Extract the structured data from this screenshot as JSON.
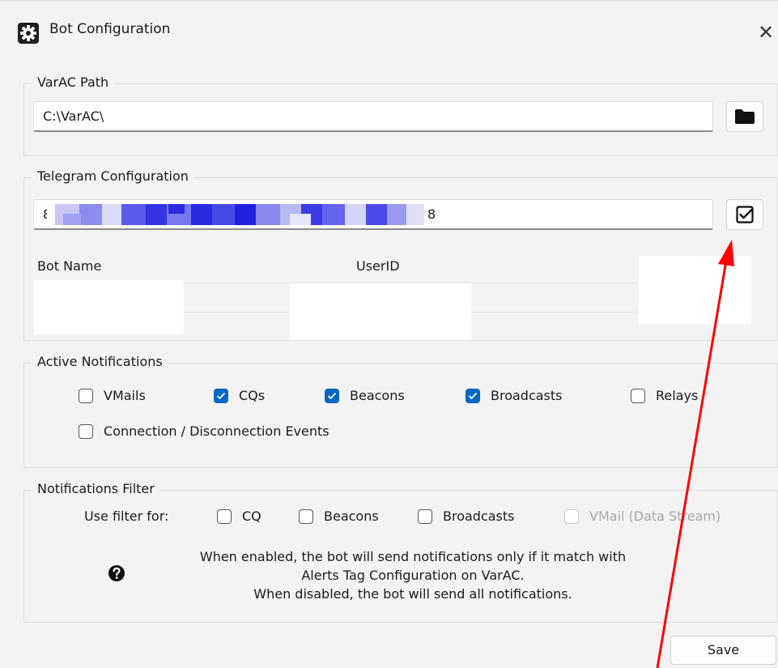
{
  "window": {
    "title": "Bot Configuration",
    "close_glyph": "✕"
  },
  "varac": {
    "legend": "VarAC Path",
    "path_value": "C:\\VarAC\\",
    "browse_icon": "folder-icon"
  },
  "telegram": {
    "legend": "Telegram Configuration",
    "token_prefix": "8:",
    "token_suffix": "8",
    "verify_icon": "checkbox-check-icon",
    "bot_name_label": "Bot Name",
    "userid_label": "UserID"
  },
  "active_notifications": {
    "legend": "Active Notifications",
    "items": [
      {
        "label": "VMails",
        "checked": false
      },
      {
        "label": "CQs",
        "checked": true
      },
      {
        "label": "Beacons",
        "checked": true
      },
      {
        "label": "Broadcasts",
        "checked": true
      },
      {
        "label": "Relays",
        "checked": false
      },
      {
        "label": "Connection / Disconnection Events",
        "checked": false
      }
    ]
  },
  "filter": {
    "legend": "Notifications Filter",
    "use_filter_label": "Use filter for:",
    "items": [
      {
        "label": "CQ",
        "checked": false,
        "enabled": true
      },
      {
        "label": "Beacons",
        "checked": false,
        "enabled": true
      },
      {
        "label": "Broadcasts",
        "checked": false,
        "enabled": true
      },
      {
        "label": "VMail (Data Stream)",
        "checked": false,
        "enabled": false
      }
    ],
    "help_lines": [
      "When enabled, the bot will send notifications only if it match with",
      "Alerts Tag Configuration on VarAC.",
      "When disabled, the bot will send all notifications."
    ],
    "help_icon": "question-circle-icon"
  },
  "footer": {
    "save_label": "Save"
  },
  "colors": {
    "accent": "#0067c0",
    "annotation_arrow": "#ff0000",
    "background": "#f3f3f3"
  }
}
